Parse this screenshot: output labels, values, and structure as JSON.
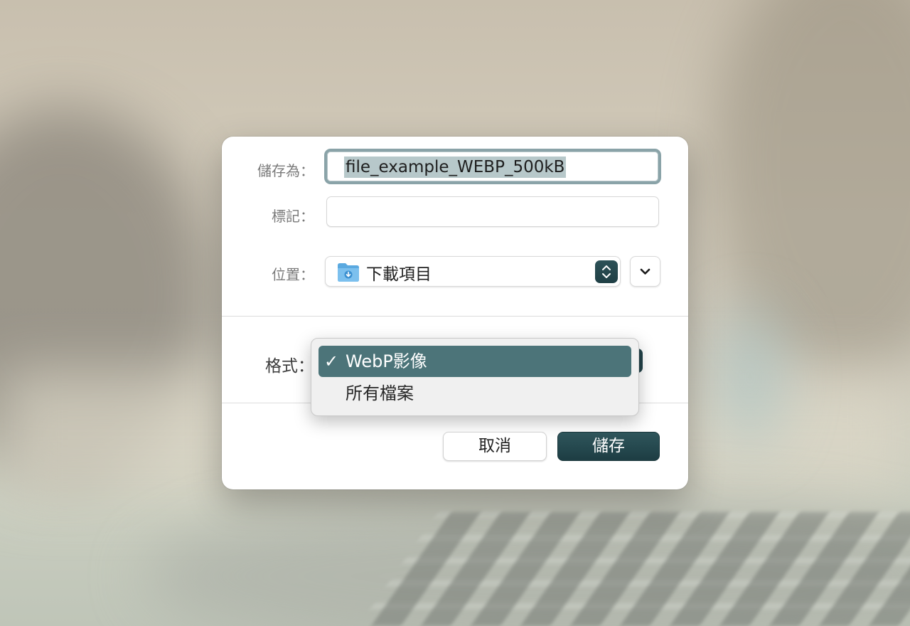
{
  "dialog": {
    "save_as_label": "儲存為：",
    "filename_value": "file_example_WEBP_500kB",
    "tags_label": "標記：",
    "tags_value": "",
    "location_label": "位置：",
    "location_value": "下載項目",
    "format_label": "格式："
  },
  "format_menu": {
    "items": [
      {
        "label": "WebP影像",
        "checked": true,
        "check_glyph": "✓"
      },
      {
        "label": "所有檔案",
        "checked": false
      }
    ]
  },
  "buttons": {
    "cancel_label": "取消",
    "save_label": "儲存"
  },
  "colors": {
    "accent": "#23434a",
    "menu_highlight": "#4c7479",
    "focus_ring": "#8aa3a8",
    "selection": "#b7c8ca"
  },
  "icons": {
    "location": "downloads-folder-icon",
    "stepper": "updown-chevron-icon",
    "expand": "chevron-down-icon"
  }
}
